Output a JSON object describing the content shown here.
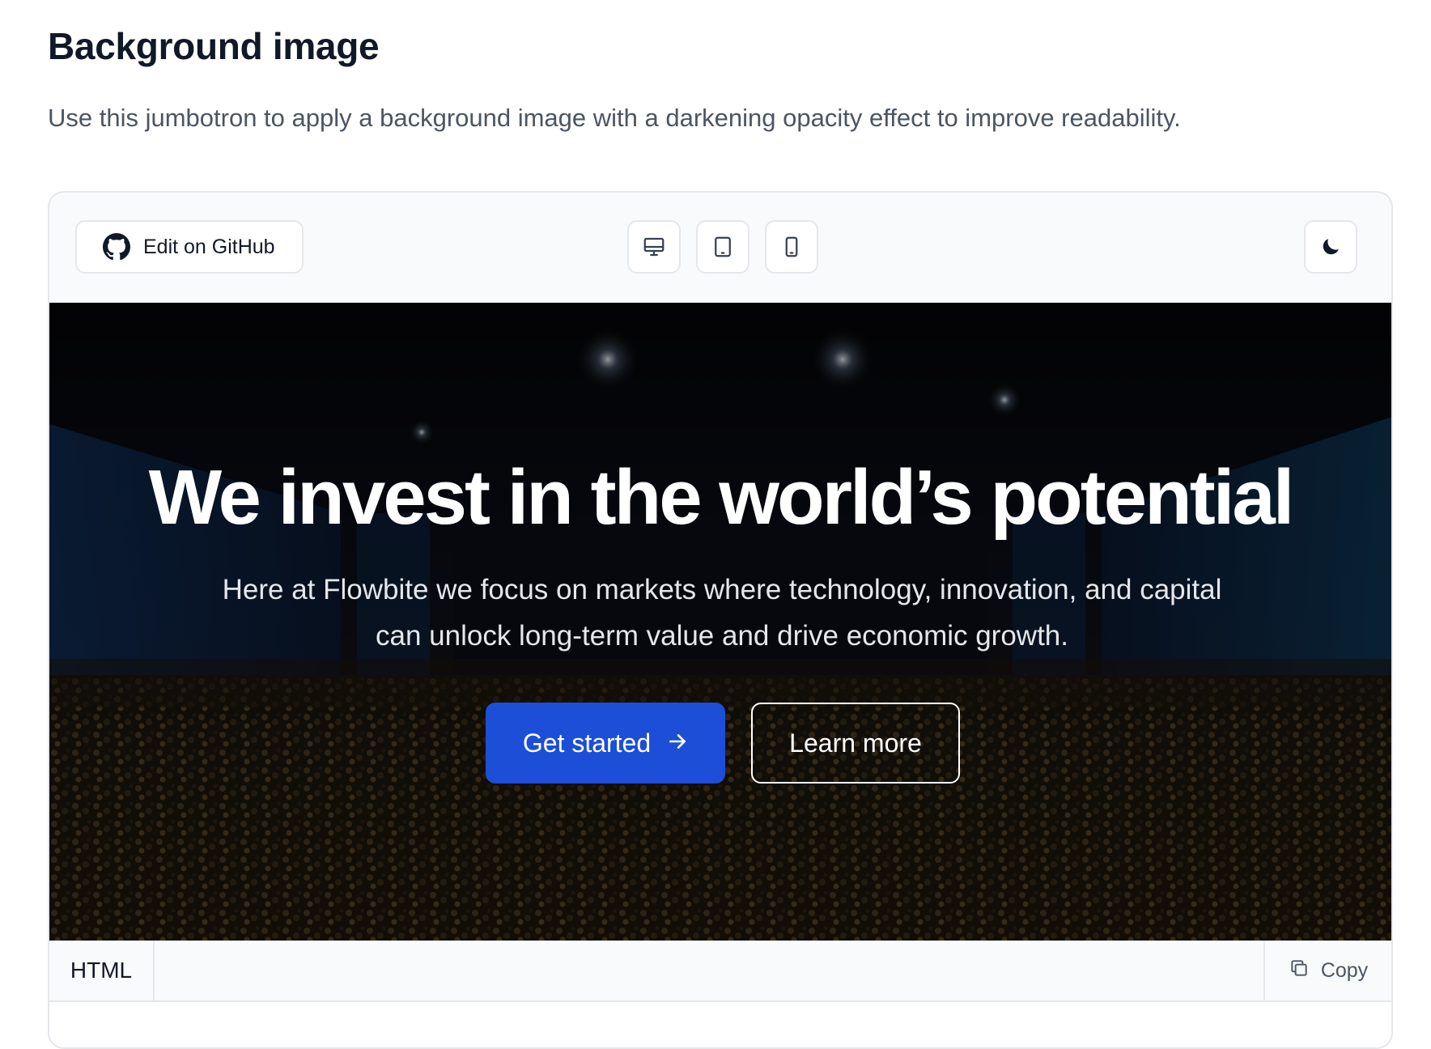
{
  "section": {
    "title": "Background image",
    "description": "Use this jumbotron to apply a background image with a darkening opacity effect to improve readability."
  },
  "toolbar": {
    "github_label": "Edit on GitHub",
    "icons": {
      "github": "github-icon",
      "desktop": "desktop-icon",
      "tablet": "tablet-icon",
      "mobile": "mobile-icon",
      "theme": "moon-icon"
    }
  },
  "hero": {
    "title": "We invest in the world’s potential",
    "subtitle": "Here at Flowbite we focus on markets where technology, innovation, and capital can unlock long-term value and drive economic growth.",
    "primary_button": "Get started",
    "secondary_button": "Learn more"
  },
  "code_panel": {
    "tab_label": "HTML",
    "copy_label": "Copy"
  },
  "colors": {
    "primary": "#1d4ed8",
    "text_dark": "#111827",
    "text_muted": "#4b5563",
    "border": "#e5e7eb"
  }
}
